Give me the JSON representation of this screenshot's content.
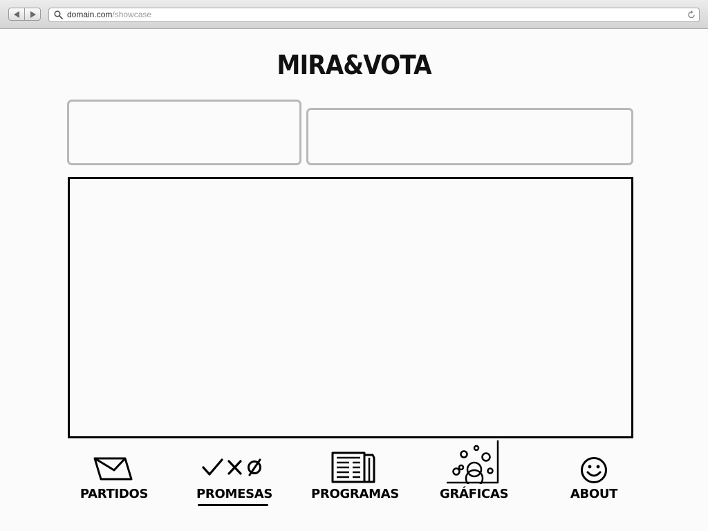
{
  "browser": {
    "url_domain": "domain.com",
    "url_path": "/showcase",
    "icons": {
      "back": "back-arrow-icon",
      "forward": "forward-arrow-icon",
      "search": "magnifier-icon",
      "reload": "reload-icon"
    }
  },
  "app": {
    "logo": "MIRA&VOTA"
  },
  "nav": {
    "items": [
      {
        "label": "PARTIDOS",
        "icon": "envelope-icon"
      },
      {
        "label": "PROMESAS",
        "icon": "check-cross-null-icon",
        "active": true
      },
      {
        "label": "PROGRAMAS",
        "icon": "documents-icon"
      },
      {
        "label": "GRÁFICAS",
        "icon": "bubble-chart-icon"
      },
      {
        "label": "ABOUT",
        "icon": "smiley-icon"
      }
    ]
  },
  "colors": {
    "background": "#fbfbfb",
    "box_border": "#b8b8b8",
    "panel_border": "#000000"
  }
}
